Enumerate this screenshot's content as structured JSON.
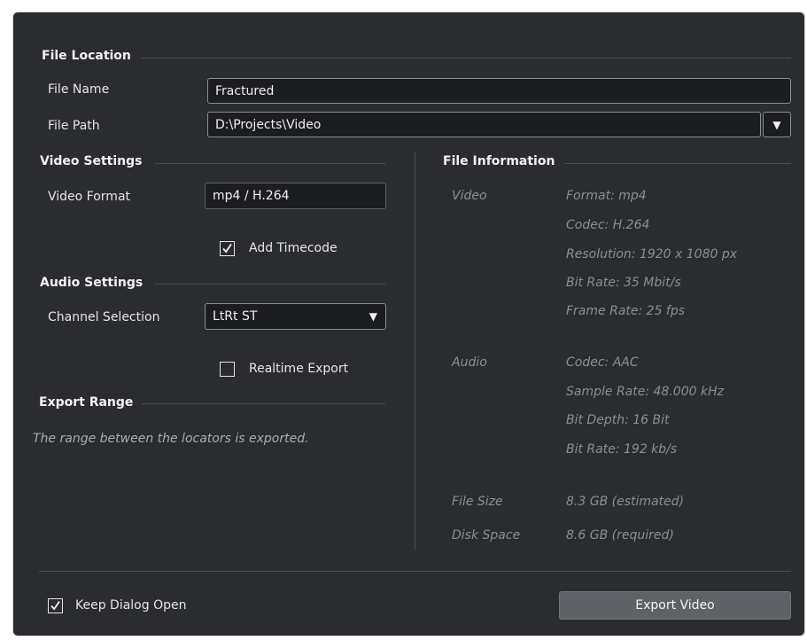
{
  "file_location": {
    "heading": "File Location",
    "file_name": {
      "label": "File Name",
      "value": "Fractured"
    },
    "file_path": {
      "label": "File Path",
      "value": "D:\\Projects\\Video"
    }
  },
  "video_settings": {
    "heading": "Video Settings",
    "video_format": {
      "label": "Video Format",
      "value": "mp4 / H.264"
    },
    "add_timecode": {
      "label": "Add Timecode",
      "checked": true
    }
  },
  "audio_settings": {
    "heading": "Audio Settings",
    "channel_selection": {
      "label": "Channel Selection",
      "value": "LtRt ST"
    },
    "realtime_export": {
      "label": "Realtime Export",
      "checked": false
    }
  },
  "export_range": {
    "heading": "Export Range",
    "note": "The range between the locators is exported."
  },
  "file_information": {
    "heading": "File Information",
    "video_label": "Video",
    "video_lines": [
      "Format: mp4",
      "Codec: H.264",
      "Resolution: 1920 x 1080 px",
      "Bit Rate: 35 Mbit/s",
      "Frame Rate: 25 fps"
    ],
    "audio_label": "Audio",
    "audio_lines": [
      "Codec: AAC",
      "Sample Rate: 48.000 kHz",
      "Bit Depth: 16 Bit",
      "Bit Rate: 192 kb/s"
    ],
    "file_size_label": "File Size",
    "file_size_value": "8.3 GB (estimated)",
    "disk_space_label": "Disk Space",
    "disk_space_value": "8.6 GB (required)"
  },
  "footer": {
    "keep_open": {
      "label": "Keep Dialog Open",
      "checked": true
    },
    "export_button": "Export Video"
  },
  "icons": {
    "dropdown": "triangle-down-icon",
    "checkmark": "checkmark-icon"
  },
  "colors": {
    "background": "#2a2c2f",
    "field": "#1c1d20",
    "button": "#5e6166"
  }
}
